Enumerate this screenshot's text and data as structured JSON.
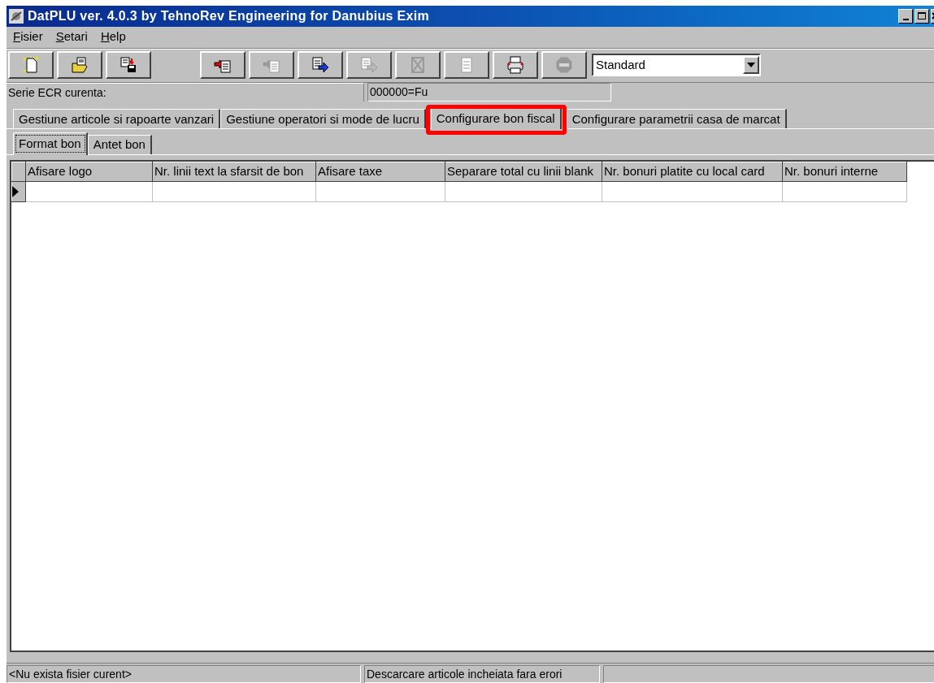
{
  "window": {
    "title": "DatPLU ver. 4.0.3 by TehnoRev Engineering for Danubius Exim"
  },
  "menu": [
    {
      "label": "Fisier"
    },
    {
      "label": "Setari"
    },
    {
      "label": "Help"
    }
  ],
  "toolbar": [
    {
      "kind": "new",
      "disabled": false
    },
    {
      "kind": "open",
      "disabled": false
    },
    {
      "kind": "save",
      "disabled": false
    },
    {
      "kind": "import",
      "disabled": false
    },
    {
      "kind": "import",
      "disabled": true
    },
    {
      "kind": "export",
      "disabled": false
    },
    {
      "kind": "export",
      "disabled": true
    },
    {
      "kind": "delete",
      "disabled": true
    },
    {
      "kind": "document",
      "disabled": true
    },
    {
      "kind": "print",
      "disabled": false
    },
    {
      "kind": "stop",
      "disabled": true
    }
  ],
  "mode_select": {
    "value": "Standard"
  },
  "info_bar": {
    "label": "Serie ECR curenta:",
    "value": "000000=Fu"
  },
  "tabs": [
    {
      "label": "Gestiune articole si rapoarte vanzari",
      "selected": false,
      "highlighted": false
    },
    {
      "label": "Gestiune operatori si mode de lucru",
      "selected": false,
      "highlighted": false
    },
    {
      "label": "Configurare bon fiscal",
      "selected": true,
      "highlighted": true
    },
    {
      "label": "Configurare parametrii casa de marcat",
      "selected": false,
      "highlighted": false
    }
  ],
  "subtabs": [
    {
      "label": "Format bon",
      "selected": true
    },
    {
      "label": "Antet bon",
      "selected": false
    }
  ],
  "table": {
    "columns": [
      "Afisare logo",
      "Nr. linii text la sfarsit de bon",
      "Afisare taxe",
      "Separare total cu linii blank",
      "Nr. bonuri platite cu local card",
      "Nr. bonuri interne"
    ],
    "rows": [
      {
        "current": true,
        "cells": [
          "",
          "",
          "",
          "",
          "",
          ""
        ]
      }
    ]
  },
  "status_bar": [
    "<Nu exista fisier curent>",
    "Descarcare articole incheiata fara erori"
  ]
}
